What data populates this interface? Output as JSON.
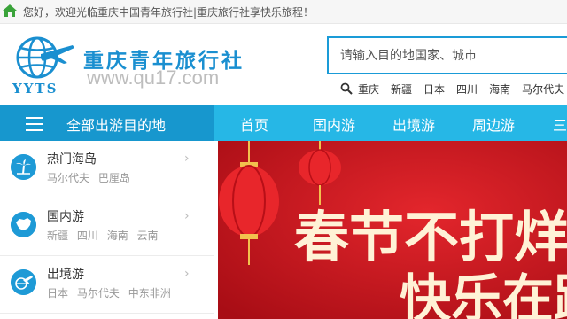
{
  "topbar": {
    "welcome": "您好，欢迎光临重庆中国青年旅行社|重庆旅行社享快乐旅程！"
  },
  "header": {
    "logo_text": "YYTS",
    "brand_cn": "重庆青年旅行社",
    "brand_url": "www.qu17.com"
  },
  "search": {
    "placeholder": "请输入目的地国家、城市",
    "value": ""
  },
  "hot_destinations": [
    "重庆",
    "新疆",
    "日本",
    "四川",
    "海南",
    "马尔代夫"
  ],
  "nav": {
    "all_label": "全部出游目的地",
    "items": [
      "首页",
      "国内游",
      "出境游",
      "周边游",
      "三"
    ]
  },
  "categories": [
    {
      "title": "热门海岛",
      "subs": [
        "马尔代夫",
        "巴厘岛"
      ]
    },
    {
      "title": "国内游",
      "subs": [
        "新疆",
        "四川",
        "海南",
        "云南"
      ]
    },
    {
      "title": "出境游",
      "subs": [
        "日本",
        "马尔代夫",
        "中东非洲"
      ]
    }
  ],
  "banner": {
    "line1": "春节不打烊",
    "line2": "快乐在路"
  },
  "colors": {
    "accent": "#26b7e6",
    "accent_dark": "#1797ce",
    "brand": "#1a8fd0",
    "banner_red": "#c8141e"
  }
}
